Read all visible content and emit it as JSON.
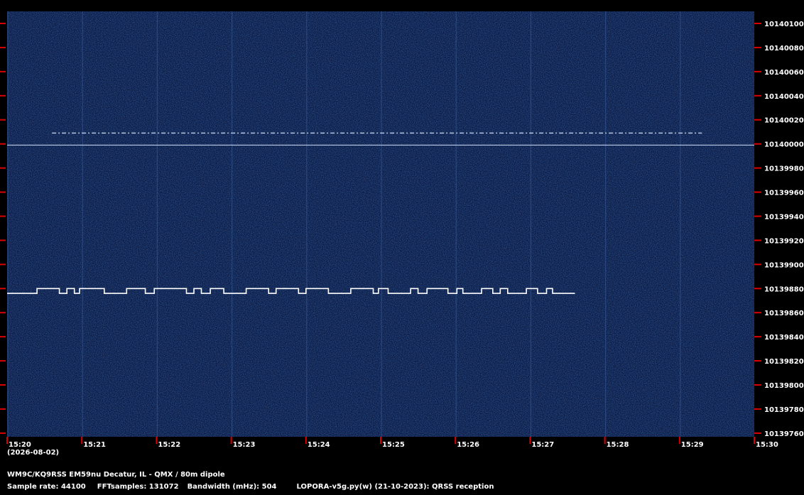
{
  "chart_data": {
    "type": "heatmap",
    "title": "",
    "xlabel": "",
    "ylabel": "",
    "x_ticks": [
      "15:20",
      "15:21",
      "15:22",
      "15:23",
      "15:24",
      "15:25",
      "15:26",
      "15:27",
      "15:28",
      "15:29",
      "15:30"
    ],
    "x_range_minutes": [
      0,
      10
    ],
    "y_ticks": [
      10140100,
      10140080,
      10140060,
      10140040,
      10140020,
      10140000,
      10139980,
      10139960,
      10139940,
      10139920,
      10139900,
      10139880,
      10139860,
      10139840,
      10139820,
      10139800,
      10139780,
      10139760
    ],
    "y_range_hz": [
      10139757,
      10140110
    ],
    "date_label": "(2026-08-02)",
    "colors": {
      "background": "#0a1a44",
      "signal": "#ffffff",
      "tick": "#dd0000",
      "axis_text": "#ffffff"
    },
    "series": [
      {
        "freq_low_hz": 10139876,
        "freq_high_hz": 10139880,
        "start_min": 0,
        "end_min": 7.6,
        "keying": [
          [
            0.0,
            0.4,
            0
          ],
          [
            0.4,
            0.7,
            1
          ],
          [
            0.7,
            0.8,
            0
          ],
          [
            0.8,
            0.9,
            1
          ],
          [
            0.9,
            0.97,
            0
          ],
          [
            0.97,
            1.3,
            1
          ],
          [
            1.3,
            1.6,
            0
          ],
          [
            1.6,
            1.85,
            1
          ],
          [
            1.85,
            1.97,
            0
          ],
          [
            1.97,
            2.4,
            1
          ],
          [
            2.4,
            2.5,
            0
          ],
          [
            2.5,
            2.6,
            1
          ],
          [
            2.6,
            2.72,
            0
          ],
          [
            2.72,
            2.9,
            1
          ],
          [
            2.9,
            3.2,
            0
          ],
          [
            3.2,
            3.5,
            1
          ],
          [
            3.5,
            3.6,
            0
          ],
          [
            3.6,
            3.9,
            1
          ],
          [
            3.9,
            4.0,
            0
          ],
          [
            4.0,
            4.3,
            1
          ],
          [
            4.3,
            4.6,
            0
          ],
          [
            4.6,
            4.9,
            1
          ],
          [
            4.9,
            4.97,
            0
          ],
          [
            4.97,
            5.1,
            1
          ],
          [
            5.1,
            5.4,
            0
          ],
          [
            5.4,
            5.5,
            1
          ],
          [
            5.5,
            5.62,
            0
          ],
          [
            5.62,
            5.9,
            1
          ],
          [
            5.9,
            6.02,
            0
          ],
          [
            6.02,
            6.1,
            1
          ],
          [
            6.1,
            6.35,
            0
          ],
          [
            6.35,
            6.5,
            1
          ],
          [
            6.5,
            6.6,
            0
          ],
          [
            6.6,
            6.7,
            1
          ],
          [
            6.7,
            6.95,
            0
          ],
          [
            6.95,
            7.1,
            1
          ],
          [
            7.1,
            7.22,
            0
          ],
          [
            7.22,
            7.3,
            1
          ],
          [
            7.3,
            7.6,
            0
          ]
        ]
      },
      {
        "freq_low_hz": 10139999,
        "freq_high_hz": 10140009,
        "start_min": 0.6,
        "end_min": 9.3,
        "keying": []
      }
    ]
  },
  "footer": {
    "station": "WM9C/KQ9RSS EM59nu Decatur, IL - QMX / 80m dipole",
    "sample_rate": "Sample rate: 44100",
    "fft_samples": "FFTsamples: 131072",
    "bandwidth": "Bandwidth (mHz): 504",
    "software": "LOPORA-v5g.py(w) (21-10-2023): QRSS reception"
  }
}
